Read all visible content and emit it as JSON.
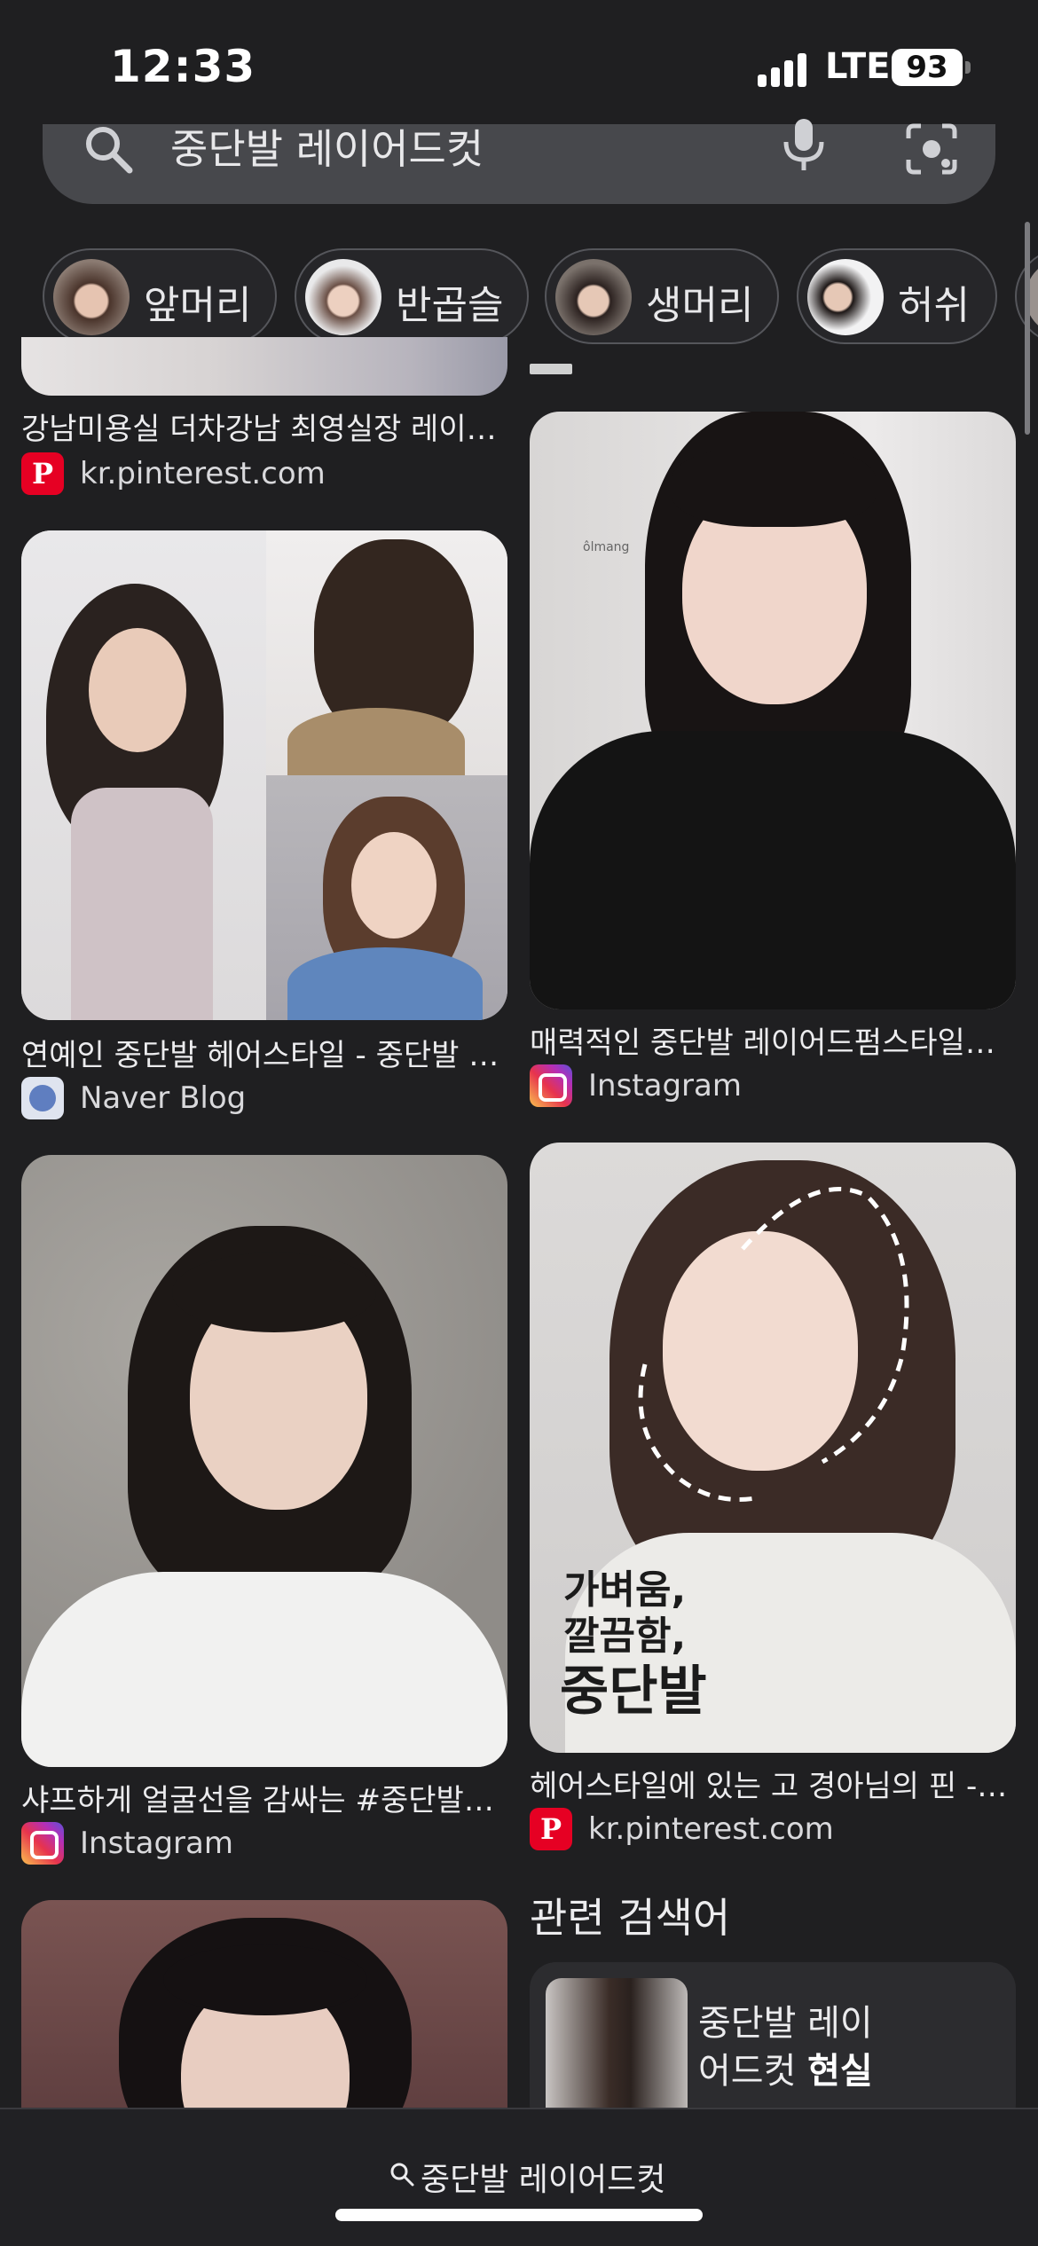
{
  "status_bar": {
    "time": "12:33",
    "network": "LTE",
    "battery": "93"
  },
  "search": {
    "query": "중단발 레이어드컷"
  },
  "chips": [
    {
      "label": "앞머리",
      "icon": "hair-thumbnail"
    },
    {
      "label": "반곱슬",
      "icon": "hair-thumbnail"
    },
    {
      "label": "생머리",
      "icon": "hair-thumbnail"
    },
    {
      "label": "허쉬",
      "icon": "hair-thumbnail"
    }
  ],
  "results": [
    {
      "title": "강남미용실 더차강남 최영실장 레이…",
      "source": "kr.pinterest.com",
      "favicon": "pinterest-icon"
    },
    {
      "title": "연예인 중단발 헤어스타일 - 중단발 …",
      "source": "Naver Blog",
      "favicon": "naver-blog-icon"
    },
    {
      "title": "샤프하게 얼굴선을 감싸는 #중단발…",
      "source": "Instagram",
      "favicon": "instagram-icon"
    },
    {
      "title": "매력적인 중단발 레이어드펌스타일…",
      "source": "Instagram",
      "favicon": "instagram-icon",
      "watermark": "ôlmang"
    },
    {
      "title": "헤어스타일에 있는 고 경아님의 핀 -…",
      "source": "kr.pinterest.com",
      "favicon": "pinterest-icon",
      "overlay_lines": [
        "가벼움,",
        "깔끔함,",
        "중단발"
      ]
    }
  ],
  "related": {
    "heading": "관련 검색어",
    "items": [
      {
        "text_line1": "중단발 레이",
        "text_line2": "어드컷",
        "text_bold": "현실"
      }
    ]
  },
  "bottom_bar": {
    "query": "중단발 레이어드컷"
  },
  "colors": {
    "background": "#1f1f21",
    "search_bar": "#47484c",
    "pinterest": "#e60023"
  }
}
